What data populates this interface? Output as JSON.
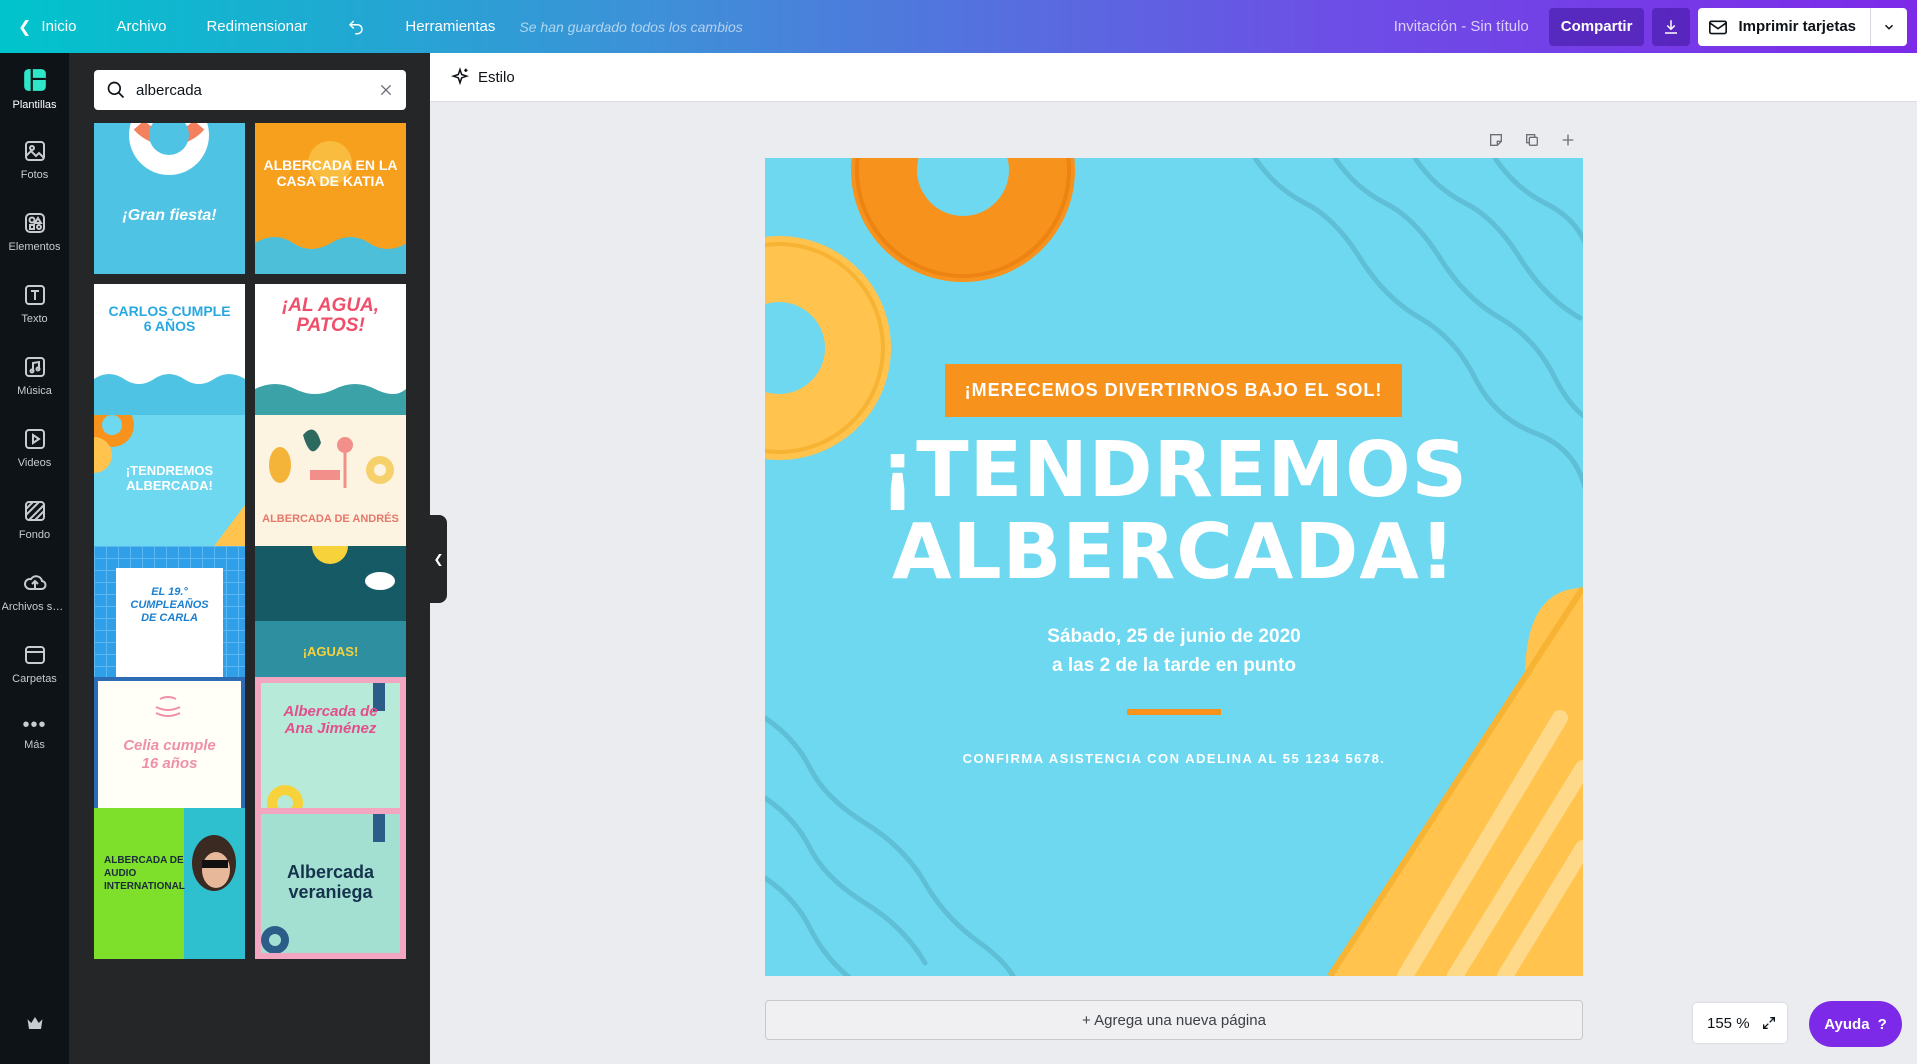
{
  "topbar": {
    "home": "Inicio",
    "file": "Archivo",
    "resize": "Redimensionar",
    "tools": "Herramientas",
    "saved": "Se han guardado todos los cambios",
    "doc_title": "Invitación - Sin título",
    "share": "Compartir",
    "print": "Imprimir tarjetas"
  },
  "rail": {
    "items": [
      {
        "label": "Plantillas",
        "icon": "templates-icon"
      },
      {
        "label": "Fotos",
        "icon": "photos-icon"
      },
      {
        "label": "Elementos",
        "icon": "elements-icon"
      },
      {
        "label": "Texto",
        "icon": "text-icon"
      },
      {
        "label": "Música",
        "icon": "music-icon"
      },
      {
        "label": "Videos",
        "icon": "video-icon"
      },
      {
        "label": "Fondo",
        "icon": "background-icon"
      },
      {
        "label": "Archivos su...",
        "icon": "upload-icon"
      },
      {
        "label": "Carpetas",
        "icon": "folder-icon"
      },
      {
        "label": "Más",
        "icon": "more-icon"
      }
    ]
  },
  "search": {
    "value": "albercada"
  },
  "templates": [
    {
      "text": "¡Gran fiesta!",
      "bg": "#4fc3e3",
      "fg": "#ffffff"
    },
    {
      "text": "ALBERCADA EN LA CASA DE KATIA",
      "bg": "#f7a01d",
      "fg": "#ffffff"
    },
    {
      "text": "CARLOS CUMPLE 6 AÑOS",
      "bg": "#ffffff",
      "fg": "#29a8e0"
    },
    {
      "text": "¡AL AGUA, PATOS!",
      "bg": "#ffffff",
      "fg": "#ef4f6b"
    },
    {
      "text": "¡TENDREMOS ALBERCADA!",
      "bg": "#6dd8ef",
      "fg": "#ffffff"
    },
    {
      "text": "ALBERCADA DE ANDRÉS",
      "bg": "#fdf3e1",
      "fg": "#e5786a"
    },
    {
      "text": "EL 19.° CUMPLEAÑOS DE CARLA",
      "bg": "#2f9fe8",
      "fg": "#1a7fd0"
    },
    {
      "text": "¡AGUAS!",
      "bg": "#2e8fa0",
      "fg": "#f7d23b"
    },
    {
      "text": "Celia cumple 16 años",
      "bg": "#fffef7",
      "fg": "#ef8fa8"
    },
    {
      "text": "Albercada de Ana Jiménez",
      "bg": "#b7ead8",
      "fg": "#e24f8d"
    },
    {
      "text": "ALBERCADA DE AUDIO INTERNATIONAL",
      "bg": "#7ee02b",
      "fg": "#1a2b3a"
    },
    {
      "text": "Albercada veraniega",
      "bg": "#a4e0d1",
      "fg": "#16334d"
    }
  ],
  "editor": {
    "style_label": "Estilo",
    "add_page": "+ Agrega una nueva página",
    "zoom": "155 %",
    "help": "Ayuda"
  },
  "design": {
    "banner": "¡MERECEMOS DIVERTIRNOS BAJO EL SOL!",
    "headline_1": "¡TENDREMOS",
    "headline_2": "ALBERCADA!",
    "date_1": "Sábado, 25 de junio de 2020",
    "date_2": "a las 2 de la tarde en punto",
    "rsvp": "CONFIRMA ASISTENCIA CON ADELINA AL 55 1234 5678."
  },
  "colors": {
    "brand_accent": "#7d2ae8",
    "canvas_bg": "#6dd8ef",
    "orange": "#f7931d",
    "yellow": "#ffc34e"
  }
}
